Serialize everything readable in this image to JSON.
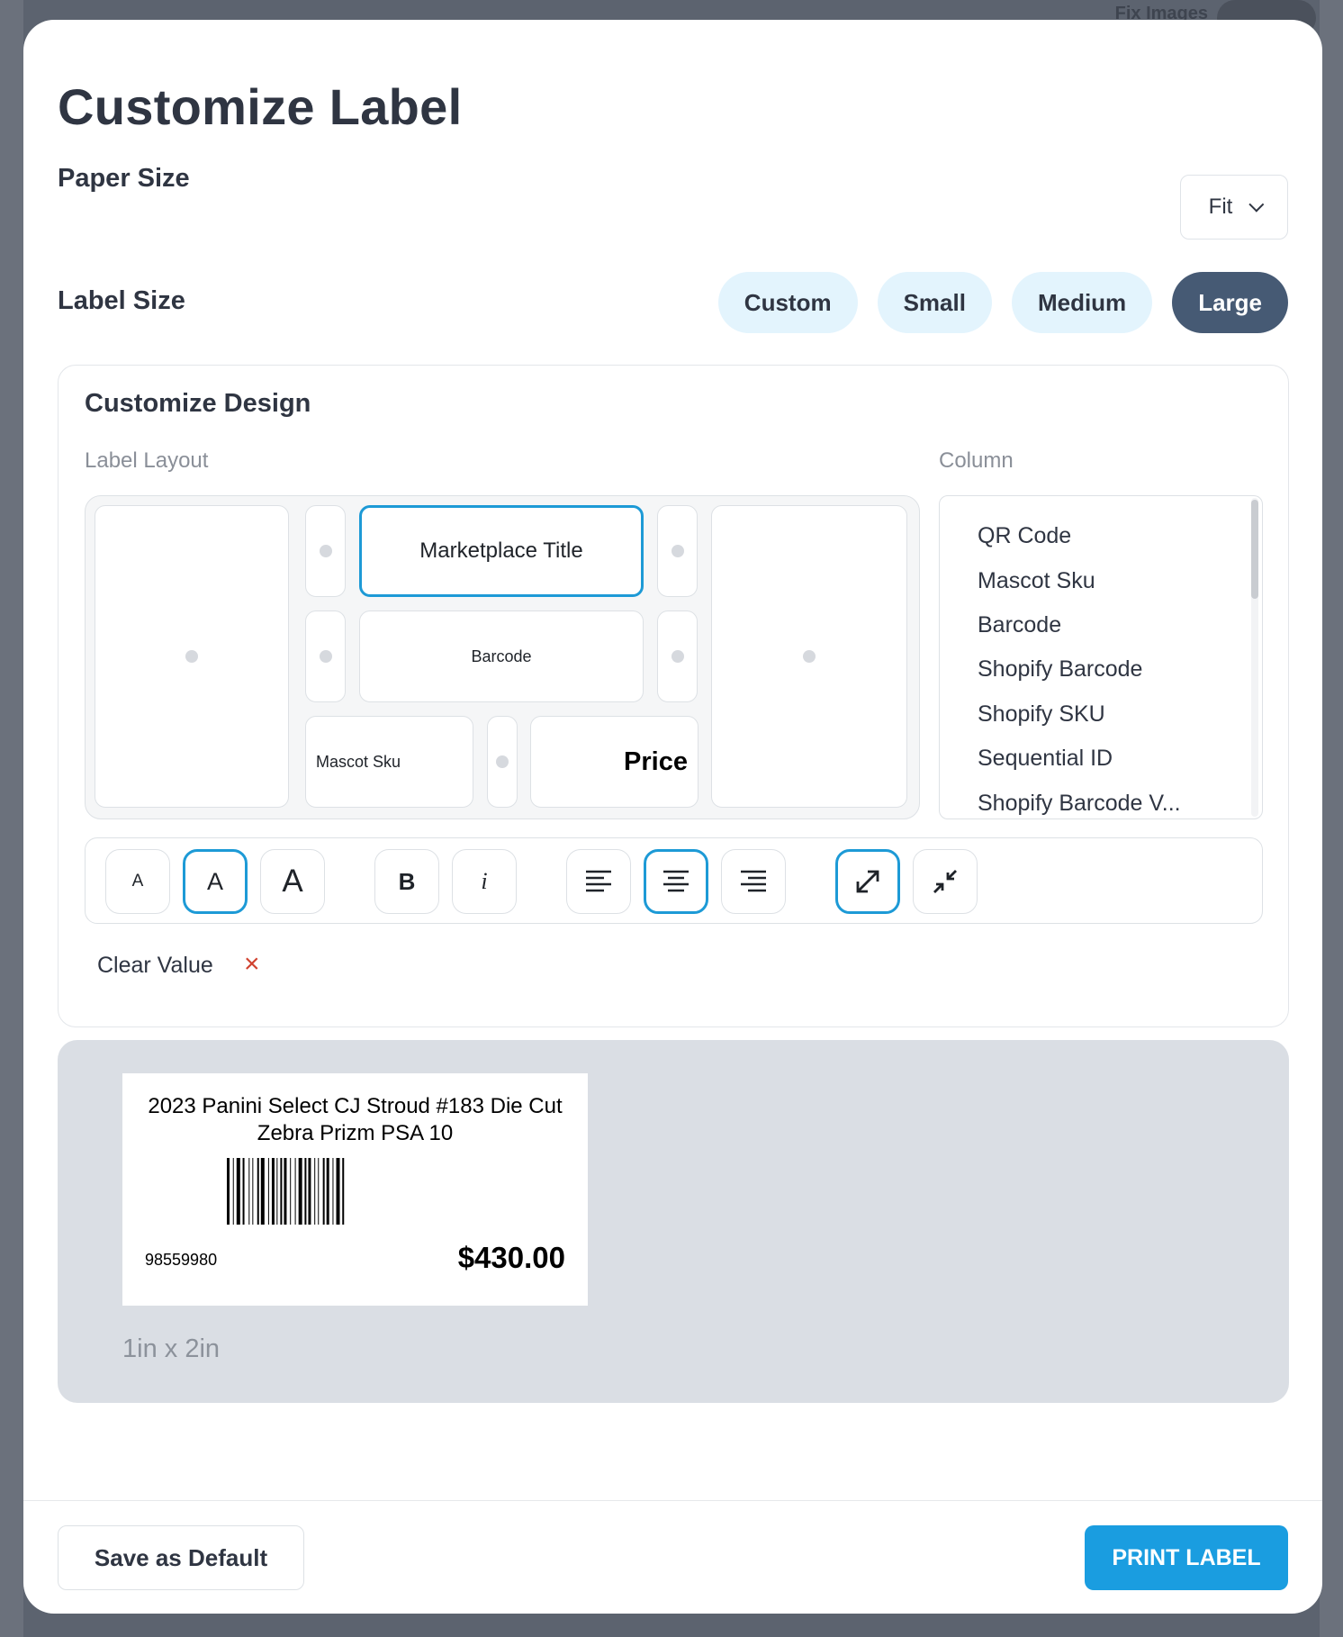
{
  "background": {
    "top_right_text": "Fix Images"
  },
  "modal": {
    "title": "Customize Label",
    "paper_size": {
      "label": "Paper Size",
      "value": "Fit"
    },
    "label_size": {
      "label": "Label Size",
      "options": [
        "Custom",
        "Small",
        "Medium",
        "Large"
      ],
      "selected": "Large"
    },
    "design": {
      "title": "Customize Design",
      "layout_label": "Label Layout",
      "column_label": "Column",
      "cells": {
        "marketplace_title": "Marketplace Title",
        "barcode": "Barcode",
        "mascot_sku": "Mascot Sku",
        "price": "Price"
      },
      "columns": [
        "QR Code",
        "Mascot Sku",
        "Barcode",
        "Shopify Barcode",
        "Shopify SKU",
        "Sequential ID",
        "Shopify Barcode V..."
      ],
      "toolbar": {
        "font_small": "A",
        "font_medium": "A",
        "font_large": "A",
        "bold": "B",
        "italic": "i"
      },
      "clear_value": "Clear Value",
      "clear_icon": "×"
    },
    "preview": {
      "title": "2023 Panini Select CJ Stroud #183 Die Cut Zebra Prizm PSA 10",
      "sku": "98559980",
      "price": "$430.00",
      "dimensions": "1in x 2in"
    },
    "footer": {
      "save_default": "Save as Default",
      "print": "PRINT LABEL"
    },
    "colors": {
      "accent": "#1a9de0",
      "selected_pill": "#465a74",
      "pill": "#e3f4fd",
      "clear": "#d0422f"
    }
  }
}
